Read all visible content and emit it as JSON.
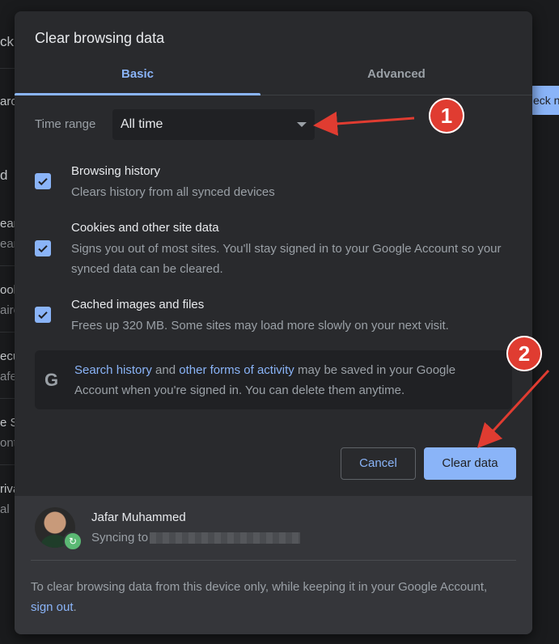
{
  "background_fragments": [
    "ck",
    "aro",
    "d",
    "ear",
    "ear",
    "ook",
    "airo",
    "ecu",
    "afe",
    "e S",
    "ont",
    "riva",
    "al",
    "eck n"
  ],
  "dialog": {
    "title": "Clear browsing data",
    "tabs": [
      {
        "label": "Basic",
        "active": true
      },
      {
        "label": "Advanced",
        "active": false
      }
    ],
    "time_range": {
      "label": "Time range",
      "value": "All time"
    },
    "options": [
      {
        "title": "Browsing history",
        "description": "Clears history from all synced devices",
        "checked": true
      },
      {
        "title": "Cookies and other site data",
        "description": "Signs you out of most sites. You'll stay signed in to your Google Account so your synced data can be cleared.",
        "checked": true
      },
      {
        "title": "Cached images and files",
        "description": "Frees up 320 MB. Some sites may load more slowly on your next visit.",
        "checked": true
      }
    ],
    "notice": {
      "icon": "G",
      "link1": "Search history",
      "text1": " and ",
      "link2": "other forms of activity",
      "text2": " may be saved in your Google Account when you're signed in. You can delete them anytime."
    },
    "buttons": {
      "cancel": "Cancel",
      "clear": "Clear data"
    },
    "account": {
      "name": "Jafar Muhammed",
      "sync_prefix": "Syncing to",
      "sync_target_redacted": true
    },
    "footer": {
      "text": "To clear browsing data from this device only, while keeping it in your Google Account, ",
      "link": "sign out",
      "suffix": "."
    }
  },
  "annotations": {
    "steps": [
      "1",
      "2"
    ],
    "color": "#e03c31"
  },
  "colors": {
    "accent": "#8ab4f8",
    "dialog_bg": "#292a2d",
    "page_bg": "#1a1b1d"
  }
}
